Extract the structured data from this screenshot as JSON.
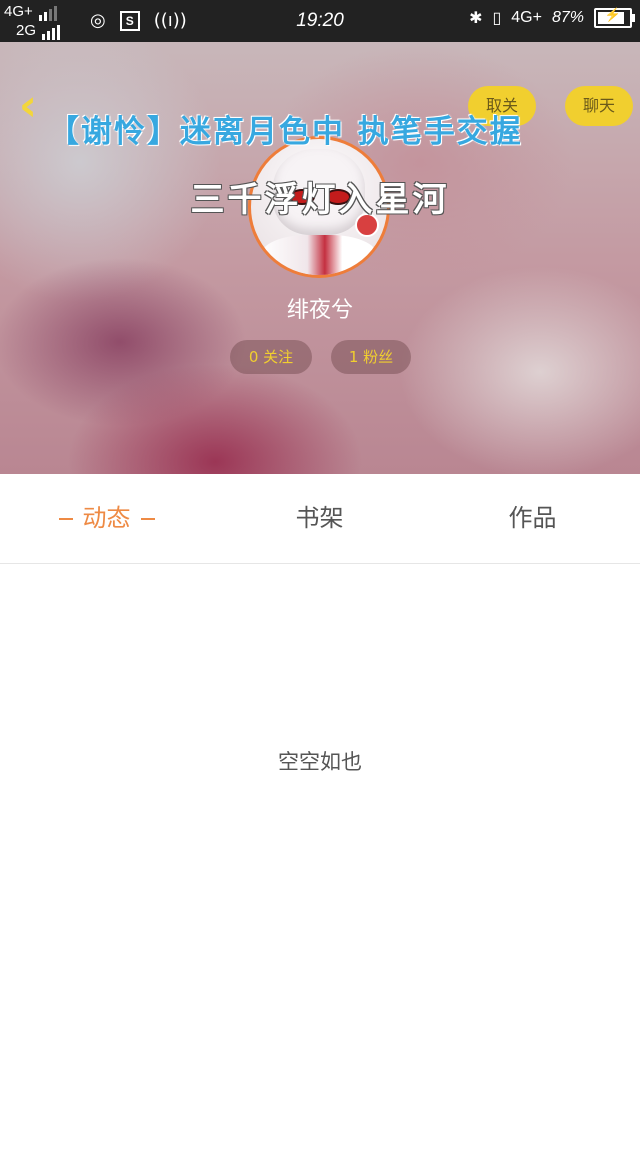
{
  "status_bar": {
    "network_1": "4G+",
    "network_2": "2G",
    "time": "19:20",
    "network_right": "4G+",
    "battery": "87%",
    "battery_level": 0.87,
    "sim_icon_label": "S"
  },
  "header": {
    "back_icon": "chevron-left-icon",
    "unfollow_label": "取关",
    "chat_label": "聊天",
    "banner_text": "【谢怜】迷离月色中 执笔手交握",
    "subtitle_text": "三千浮灯入星河",
    "username": "绯夜兮",
    "following": "0 关注",
    "fans": "1 粉丝",
    "accent_color": "#f1cf2f"
  },
  "tabs": [
    {
      "label": "动态",
      "active": true
    },
    {
      "label": "书架",
      "active": false
    },
    {
      "label": "作品",
      "active": false
    }
  ],
  "main": {
    "empty_text": "空空如也"
  },
  "colors": {
    "active_tab": "#ee8a44",
    "status_bar_bg": "#222222"
  }
}
